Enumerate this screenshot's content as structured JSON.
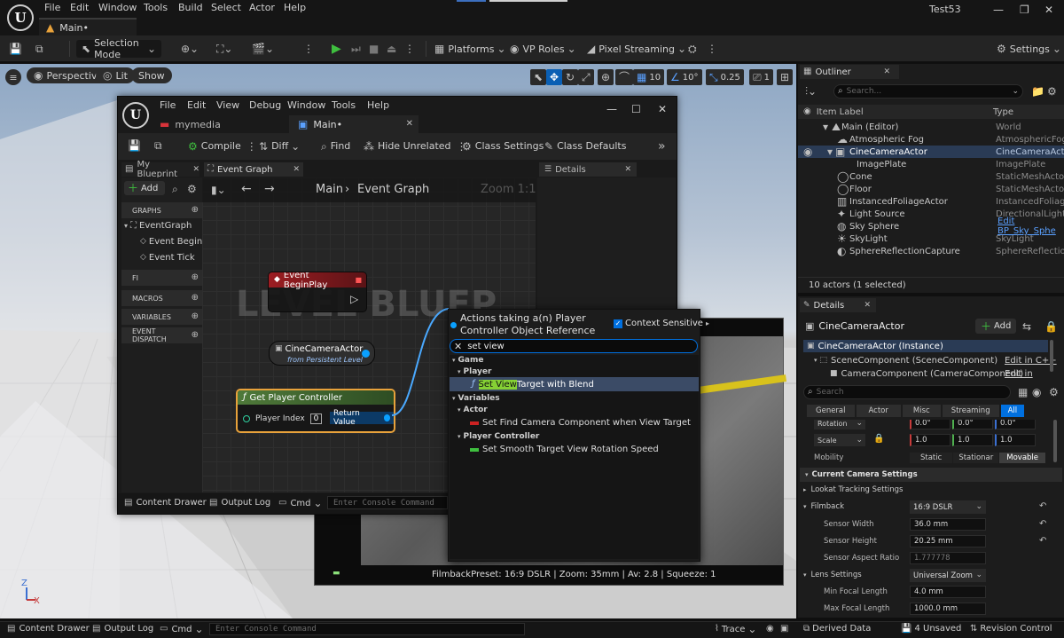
{
  "app": {
    "project": "Test53",
    "tab": "Main•"
  },
  "menu": [
    "File",
    "Edit",
    "Window",
    "Tools",
    "Build",
    "Select",
    "Actor",
    "Help"
  ],
  "toolbar": {
    "selection_mode": "Selection Mode",
    "platforms": "Platforms",
    "vp_roles": "VP Roles",
    "pixel_streaming": "Pixel Streaming",
    "settings": "Settings"
  },
  "viewport": {
    "perspective": "Perspective",
    "lit": "Lit",
    "show": "Show",
    "grid": "10",
    "angle": "10°",
    "scale": "0.25",
    "cams": "1",
    "axis_z": "Z",
    "axis_x": "X"
  },
  "blueprint": {
    "menu": [
      "File",
      "Edit",
      "View",
      "Debug",
      "Window",
      "Tools",
      "Help"
    ],
    "tab_mymedia": "mymedia",
    "tab_main": "Main•",
    "toolbar": {
      "compile": "Compile",
      "diff": "Diff",
      "find": "Find",
      "hide_unrelated": "Hide Unrelated",
      "class_settings": "Class Settings",
      "class_defaults": "Class Defaults"
    },
    "my_blueprint_tab": "My Blueprint",
    "event_graph_tab": "Event Graph",
    "details_tab": "Details",
    "add": "Add",
    "graphs": "GRAPHS",
    "event_graph": "EventGraph",
    "event_beginplay": "Event BeginPl",
    "event_tick": "Event Tick",
    "fi": "FI",
    "macros": "MACROS",
    "variables": "VARIABLES",
    "event_dispatch": "EVENT DISPATCH",
    "breadcrumb_root": "Main",
    "breadcrumb_leaf": "Event Graph",
    "zoom": "Zoom 1:1",
    "node_beginplay": "Event BeginPlay",
    "node_cine_title": "CineCameraActor",
    "node_cine_sub": "from Persistent Level",
    "node_gpc_title": "Get Player Controller",
    "node_gpc_pin": "Player Index",
    "node_gpc_val": "0",
    "node_gpc_ret": "Return Value",
    "watermark": "LEVEL BLUEP",
    "content_drawer": "Content Drawer",
    "output_log": "Output Log",
    "cmd": "Cmd",
    "console_ph": "Enter Console Command"
  },
  "actions": {
    "title_1": "Actions taking a(n) Player",
    "title_2": "Controller Object Reference",
    "context": "Context Sensitive",
    "search": "set view",
    "cat_game": "Game",
    "cat_player": "Player",
    "item_1_hl": "Set View",
    "item_1_rest": " Target with Blend",
    "cat_vars": "Variables",
    "cat_actor": "Actor",
    "item_2": "Set Find Camera Component when View Target",
    "cat_pc": "Player Controller",
    "item_3": "Set Smooth Target View Rotation Speed"
  },
  "filmback_overlay": "FilmbackPreset: 16:9 DSLR | Zoom: 35mm | Av: 2.8 | Squeeze: 1",
  "outliner": {
    "title": "Outliner",
    "search_ph": "Search...",
    "col_label": "Item Label",
    "col_type": "Type",
    "rows": [
      {
        "label": "Main (Editor)",
        "type": "World"
      },
      {
        "label": "Atmospheric Fog",
        "type": "AtmosphericFog"
      },
      {
        "label": "CineCameraActor",
        "type": "CineCameraActor"
      },
      {
        "label": "ImagePlate",
        "type": "ImagePlate"
      },
      {
        "label": "Cone",
        "type": "StaticMeshActor"
      },
      {
        "label": "Floor",
        "type": "StaticMeshActor"
      },
      {
        "label": "InstancedFoliageActor",
        "type": "InstancedFoliageA"
      },
      {
        "label": "Light Source",
        "type": "DirectionalLight"
      },
      {
        "label": "Sky Sphere",
        "type": "Edit BP_Sky_Sphe"
      },
      {
        "label": "SkyLight",
        "type": "SkyLight"
      },
      {
        "label": "SphereReflectionCapture",
        "type": "SphereReflectionC"
      }
    ],
    "count": "10 actors (1 selected)"
  },
  "details": {
    "title": "Details",
    "actor": "CineCameraActor",
    "add": "Add",
    "instance": "CineCameraActor (Instance)",
    "comp_1": "SceneComponent (SceneComponent)",
    "comp_1_edit": "Edit in C++",
    "comp_2": "CameraComponent (CameraComponent)",
    "comp_2_edit": "Edit in C++",
    "search_ph": "Search",
    "filters": [
      "General",
      "Actor",
      "Misc",
      "Streaming",
      "All"
    ],
    "rotation_label": "Rotation",
    "rot_vals": [
      "0.0°",
      "0.0°",
      "0.0°"
    ],
    "scale_label": "Scale",
    "scale_vals": [
      "1.0",
      "1.0",
      "1.0"
    ],
    "mobility_label": "Mobility",
    "mobility": [
      "Static",
      "Stationar",
      "Movable"
    ],
    "sec_current": "Current Camera Settings",
    "sec_lookat": "Lookat Tracking Settings",
    "filmback_label": "Filmback",
    "filmback_val": "16:9 DSLR",
    "sw_label": "Sensor Width",
    "sw_val": "36.0 mm",
    "sh_label": "Sensor Height",
    "sh_val": "20.25 mm",
    "sar_label": "Sensor Aspect Ratio",
    "sar_val": "1.777778",
    "lens_label": "Lens Settings",
    "lens_val": "Universal Zoom",
    "minf_label": "Min Focal Length",
    "minf_val": "4.0 mm",
    "maxf_label": "Max Focal Length",
    "maxf_val": "1000.0 mm"
  },
  "statusbar": {
    "content_drawer": "Content Drawer",
    "output_log": "Output Log",
    "cmd": "Cmd",
    "console_ph": "Enter Console Command",
    "trace": "Trace",
    "derived": "Derived Data",
    "unsaved": "4 Unsaved",
    "revision": "Revision Control"
  },
  "colors": {
    "accent": "#0070e0",
    "selected_row": "#2a3b55",
    "exec_red": "#d8333a",
    "play_green": "#3fbf3f",
    "node_green": "#3d6a2d",
    "highlight": "#85d134"
  }
}
